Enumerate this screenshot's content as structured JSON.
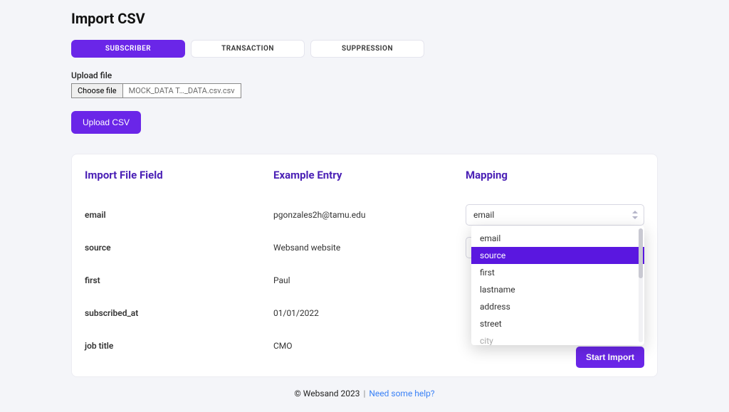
{
  "page": {
    "title": "Import CSV"
  },
  "tabs": {
    "subscriber": "SUBSCRIBER",
    "transaction": "TRANSACTION",
    "suppression": "SUPPRESSION"
  },
  "upload": {
    "label": "Upload file",
    "choose_button": "Choose file",
    "filename": "MOCK_DATA T…_DATA.csv.csv",
    "upload_button": "Upload CSV"
  },
  "mapping_card": {
    "headers": {
      "field": "Import File Field",
      "example": "Example Entry",
      "mapping": "Mapping"
    },
    "rows": [
      {
        "field": "email",
        "example": "pgonzales2h@tamu.edu",
        "mapping": "email"
      },
      {
        "field": "source",
        "example": "Websand website",
        "mapping": ""
      },
      {
        "field": "first",
        "example": "Paul",
        "mapping": ""
      },
      {
        "field": "subscribed_at",
        "example": "01/01/2022",
        "mapping": ""
      },
      {
        "field": "job title",
        "example": "CMO",
        "mapping": ""
      }
    ],
    "mapping_options": [
      "email",
      "source",
      "first",
      "lastname",
      "address",
      "street",
      "city"
    ],
    "dropdown_highlight_index": 1,
    "start_import_button": "Start Import"
  },
  "footer": {
    "copyright": "© Websand 2023",
    "help_link": "Need some help?"
  },
  "colors": {
    "accent": "#6a26e8"
  }
}
